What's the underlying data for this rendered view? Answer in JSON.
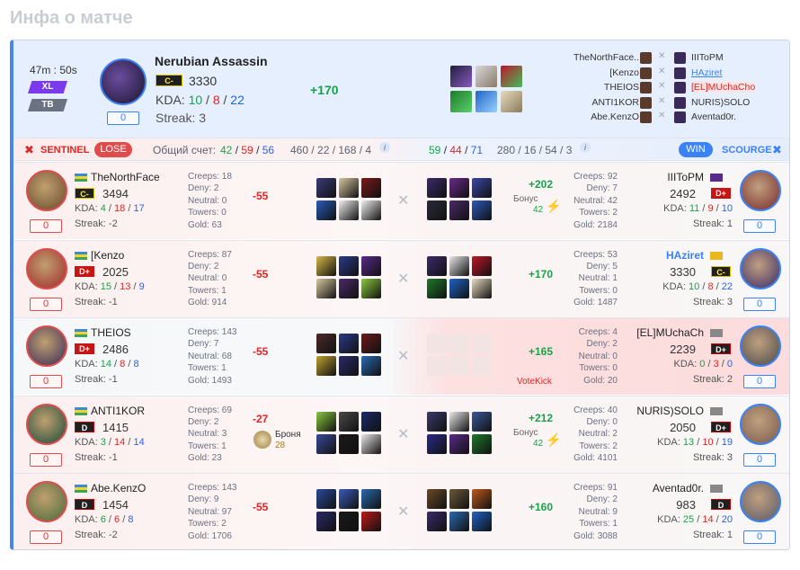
{
  "page_title": "Инфа о матче",
  "match": {
    "duration": "47m : 50s",
    "mode1": "XL",
    "mode2": "TB",
    "hero": "Nerubian Assassin",
    "rank": "C-",
    "rating": "3330",
    "kda_label": "KDA:",
    "kda": [
      "10",
      "8",
      "22"
    ],
    "streak": "Streak: 3",
    "delta": "+170",
    "zero": "0"
  },
  "top_players": [
    {
      "left": "TheNorthFace..",
      "right": "IIIToPM"
    },
    {
      "left": "[Kenzo",
      "right": "HAziret"
    },
    {
      "left": "THEIOS",
      "right": "[EL]MUchaCho"
    },
    {
      "left": "ANTI1KOR",
      "right": "NURIS)SOLO"
    },
    {
      "left": "Abe.KenzO",
      "right": "Aventad0r."
    }
  ],
  "bar": {
    "sentinel": "SENTINEL",
    "lose": "LOSE",
    "total_label": "Общий счет:",
    "s_k": "42",
    "s_d": "59",
    "s_a": "56",
    "s_cd": "460 / 22 / 168 / 4",
    "r_k": "59",
    "r_d": "44",
    "r_a": "71",
    "r_cd": "280 / 16 / 54 / 3",
    "win": "WIN",
    "scourge": "SCOURGE"
  },
  "rows": [
    {
      "l": {
        "name": "TheNorthFace",
        "rank": "C-",
        "rc": "c",
        "rating": "3494",
        "kda": [
          "4",
          "18",
          "17"
        ],
        "streak": "Streak: -2",
        "creeps": "Creeps: 18",
        "deny": "Deny: 2",
        "neutral": "Neutral: 0",
        "towers": "Towers: 0",
        "gold": "Gold: 63",
        "delta": "-55"
      },
      "r": {
        "name": "IIIToPM",
        "rank": "D+",
        "rc": "d",
        "rating": "2492",
        "kda": [
          "11",
          "9",
          "10"
        ],
        "streak": "Streak: 1",
        "creeps": "Creeps: 92",
        "deny": "Deny: 7",
        "neutral": "Neutral: 42",
        "towers": "Towers: 2",
        "gold": "Gold: 2184",
        "delta": "+202",
        "bonus": "Бонус",
        "bonus_val": "42"
      }
    },
    {
      "l": {
        "name": "[Kenzo",
        "rank": "D+",
        "rc": "d",
        "rating": "2025",
        "kda": [
          "15",
          "13",
          "9"
        ],
        "streak": "Streak: -1",
        "creeps": "Creeps: 87",
        "deny": "Deny: 2",
        "neutral": "Neutral: 0",
        "towers": "Towers: 1",
        "gold": "Gold: 914",
        "delta": "-55"
      },
      "r": {
        "name": "HAziret",
        "rank": "C-",
        "rc": "c",
        "rating": "3330",
        "kda": [
          "10",
          "8",
          "22"
        ],
        "streak": "Streak: 3",
        "creeps": "Creeps: 53",
        "deny": "Deny: 5",
        "neutral": "Neutral: 1",
        "towers": "Towers: 0",
        "gold": "Gold: 1487",
        "delta": "+170"
      }
    },
    {
      "l": {
        "name": "THEIOS",
        "rank": "D+",
        "rc": "d",
        "rating": "2486",
        "kda": [
          "14",
          "8",
          "8"
        ],
        "streak": "Streak: -1",
        "creeps": "Creeps: 143",
        "deny": "Deny: 7",
        "neutral": "Neutral: 68",
        "towers": "Towers: 1",
        "gold": "Gold: 1493",
        "delta": "-55"
      },
      "r": {
        "name": "[EL]MUchaCh",
        "rank": "D+",
        "rc": "dk",
        "rating": "2239",
        "kda": [
          "0",
          "3",
          "0"
        ],
        "streak": "Streak: 2",
        "creeps": "Creeps: 4",
        "deny": "Deny: 2",
        "neutral": "Neutral: 0",
        "towers": "Towers: 0",
        "gold": "Gold: 20",
        "delta": "+165",
        "votekick": "VoteKick"
      }
    },
    {
      "l": {
        "name": "ANTI1KOR",
        "rank": "D",
        "rc": "dk",
        "rating": "1415",
        "kda": [
          "3",
          "14",
          "14"
        ],
        "streak": "Streak: -1",
        "creeps": "Creeps: 69",
        "deny": "Deny: 2",
        "neutral": "Neutral: 3",
        "towers": "Towers: 1",
        "gold": "Gold: 23",
        "delta": "-27",
        "armor": "Броня",
        "armor_val": "28"
      },
      "r": {
        "name": "NURIS)SOLO",
        "rank": "D+",
        "rc": "dk",
        "rating": "2050",
        "kda": [
          "13",
          "10",
          "19"
        ],
        "streak": "Streak: 3",
        "creeps": "Creeps: 40",
        "deny": "Deny: 0",
        "neutral": "Neutral: 2",
        "towers": "Towers: 2",
        "gold": "Gold: 4101",
        "delta": "+212",
        "bonus": "Бонус",
        "bonus_val": "42"
      }
    },
    {
      "l": {
        "name": "Abe.KenzO",
        "rank": "D",
        "rc": "dk",
        "rating": "1454",
        "kda": [
          "6",
          "6",
          "8"
        ],
        "streak": "Streak: -2",
        "creeps": "Creeps: 143",
        "deny": "Deny: 9",
        "neutral": "Neutral: 97",
        "towers": "Towers: 2",
        "gold": "Gold: 1706",
        "delta": "-55"
      },
      "r": {
        "name": "Aventad0r.",
        "rank": "D",
        "rc": "dk",
        "rating": "983",
        "kda": [
          "25",
          "14",
          "20"
        ],
        "streak": "Streak: 1",
        "creeps": "Creeps: 91",
        "deny": "Deny: 2",
        "neutral": "Neutral: 9",
        "towers": "Towers: 1",
        "gold": "Gold: 3088",
        "delta": "+160"
      }
    }
  ],
  "kda_label": "KDA:",
  "zero": "0"
}
